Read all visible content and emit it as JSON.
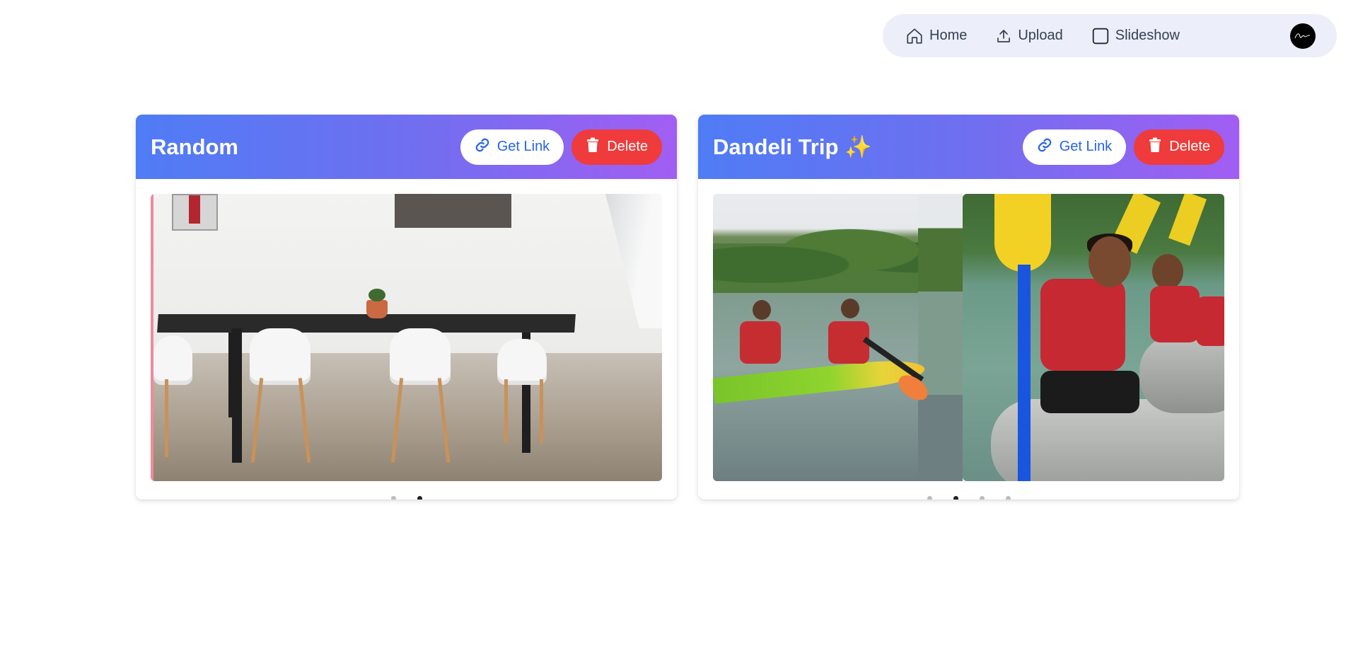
{
  "nav": {
    "items": [
      {
        "label": "Home",
        "icon": "home-icon"
      },
      {
        "label": "Upload",
        "icon": "upload-icon"
      },
      {
        "label": "Slideshow",
        "icon": "slideshow-icon"
      }
    ],
    "avatar_icon": "avatar"
  },
  "albums": [
    {
      "title": "Random",
      "get_link_label": "Get Link",
      "delete_label": "Delete",
      "slide_count": 2,
      "active_slide": 2
    },
    {
      "title": "Dandeli Trip ✨",
      "get_link_label": "Get Link",
      "delete_label": "Delete",
      "slide_count": 4,
      "active_slide": 2
    }
  ],
  "colors": {
    "header_gradient_start": "#4f7cf5",
    "header_gradient_end": "#a15ef2",
    "delete": "#ef3b3b",
    "link": "#2563eb",
    "nav_bg": "#eceef9"
  }
}
